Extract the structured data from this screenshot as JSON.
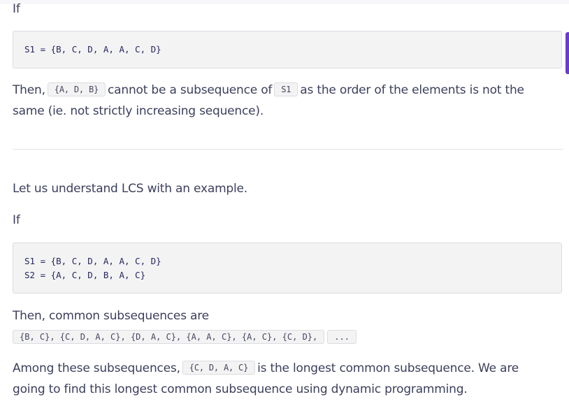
{
  "content": {
    "if1": "If",
    "code1": {
      "line1": "S1 = {B, C, D, A, A, C, D}"
    },
    "para1": {
      "text_a": "Then,",
      "code_a": "{A, D, B}",
      "text_b": "cannot be a subsequence of",
      "code_b": "S1",
      "text_c": "as the order of the elements is not the",
      "line2": "same (ie. not strictly increasing sequence)."
    },
    "intro": "Let us understand LCS with an example.",
    "if2": "If",
    "code2": {
      "line1": "S1 = {B, C, D, A, A, C, D}",
      "line2": "S2 = {A, C, D, B, A, C}"
    },
    "common_label": "Then, common subsequences are",
    "common_code": "{B, C}, {C, D, A, C}, {D, A, C}, {A, A, C}, {A, C}, {C, D},",
    "ellipsis": "...",
    "para3": {
      "text_a": "Among these subsequences,",
      "code_a": "{C, D, A, C}",
      "text_b": "is the longest common subsequence. We are",
      "line2": "going to find this longest common subsequence using dynamic programming."
    }
  },
  "colors": {
    "accent": "#6a3cc8",
    "code_bg": "#f3f3f4",
    "text": "#3b3f5c"
  }
}
